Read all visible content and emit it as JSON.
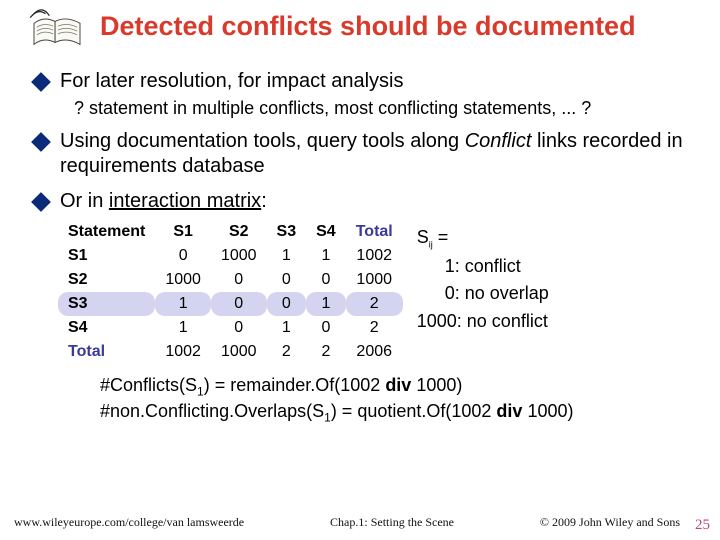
{
  "title": "Detected conflicts should be documented",
  "bullets": {
    "b1": "For later resolution,  for impact analysis",
    "b1_sub": "? statement in multiple conflicts, most conflicting statements, ... ?",
    "b2_pre": "Using documentation tools, query tools along ",
    "b2_italic": "Conflict",
    "b2_post": " links recorded in requirements database",
    "b3_pre": "Or in ",
    "b3_u": "interaction matrix",
    "b3_post": ":"
  },
  "matrix": {
    "corner": "Statement",
    "cols": [
      "S1",
      "S2",
      "S3",
      "S4"
    ],
    "total_label": "Total",
    "rows": [
      {
        "label": "S1",
        "cells": [
          "0",
          "1000",
          "1",
          "1"
        ],
        "total": "1002"
      },
      {
        "label": "S2",
        "cells": [
          "1000",
          "0",
          "0",
          "0"
        ],
        "total": "1000"
      },
      {
        "label": "S3",
        "cells": [
          "1",
          "0",
          "0",
          "1"
        ],
        "total": "2"
      },
      {
        "label": "S4",
        "cells": [
          "1",
          "0",
          "1",
          "0"
        ],
        "total": "2"
      }
    ],
    "foot": {
      "cells": [
        "1002",
        "1000",
        "2",
        "2"
      ],
      "total": "2006"
    }
  },
  "legend": {
    "title_a": "S",
    "title_b": "ij",
    "title_c": " =",
    "l1": "1: conflict",
    "l2": "0: no overlap",
    "l3": "1000: no conflict"
  },
  "formulas": {
    "f1a": "#Conflicts(S",
    "f1b": "1",
    "f1c": ") = remainder.Of(1002 ",
    "f1d": "div",
    "f1e": " 1000)",
    "f2a": "#non.Conflicting.Overlaps(S",
    "f2b": "1",
    "f2c": ") = quotient.Of(1002 ",
    "f2d": "div",
    "f2e": " 1000)"
  },
  "footer": {
    "left": "www.wileyeurope.com/college/van lamsweerde",
    "mid": "Chap.1: Setting the Scene",
    "right": "© 2009 John Wiley and Sons",
    "page": "25"
  }
}
